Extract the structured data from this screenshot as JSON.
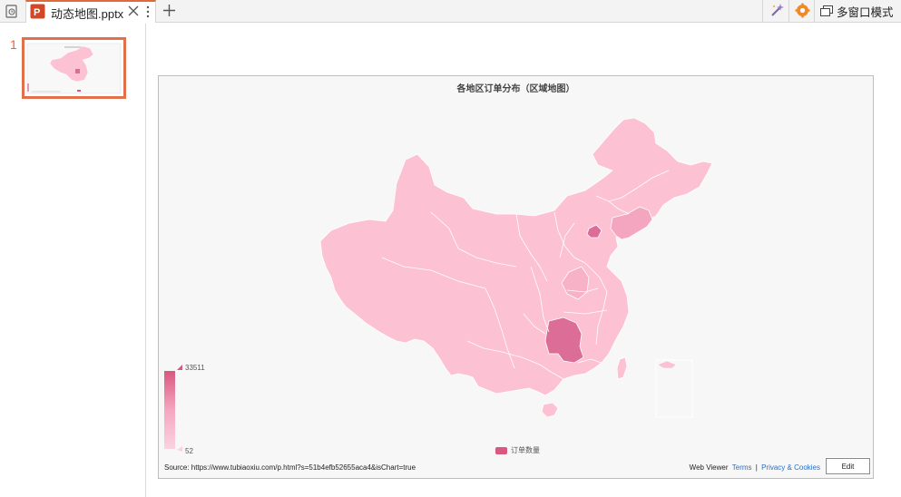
{
  "tab": {
    "title": "动态地图.pptx",
    "new_tab_label": "+"
  },
  "toolbar": {
    "multi_window_label": "多窗口模式"
  },
  "slides": {
    "items": [
      {
        "number": "1"
      }
    ]
  },
  "chart": {
    "title": "各地区订单分布（区域地图）",
    "visual_map_max": "33511",
    "visual_map_min": "52",
    "legend_label": "订单数量",
    "source": "Source: https://www.tubiaoxiu.com/p.html?s=51b4efb52655aca4&isChart=true",
    "viewer_label": "Web Viewer",
    "terms_label": "Terms",
    "separator": "|",
    "privacy_label": "Privacy & Cookies",
    "edit_label": "Edit"
  },
  "colors": {
    "accent": "#e06a3a",
    "map_base": "#fcc2d4",
    "map_mid": "#f4a6c0",
    "map_high": "#db6d96",
    "legend_swatch": "#d9587f"
  }
}
